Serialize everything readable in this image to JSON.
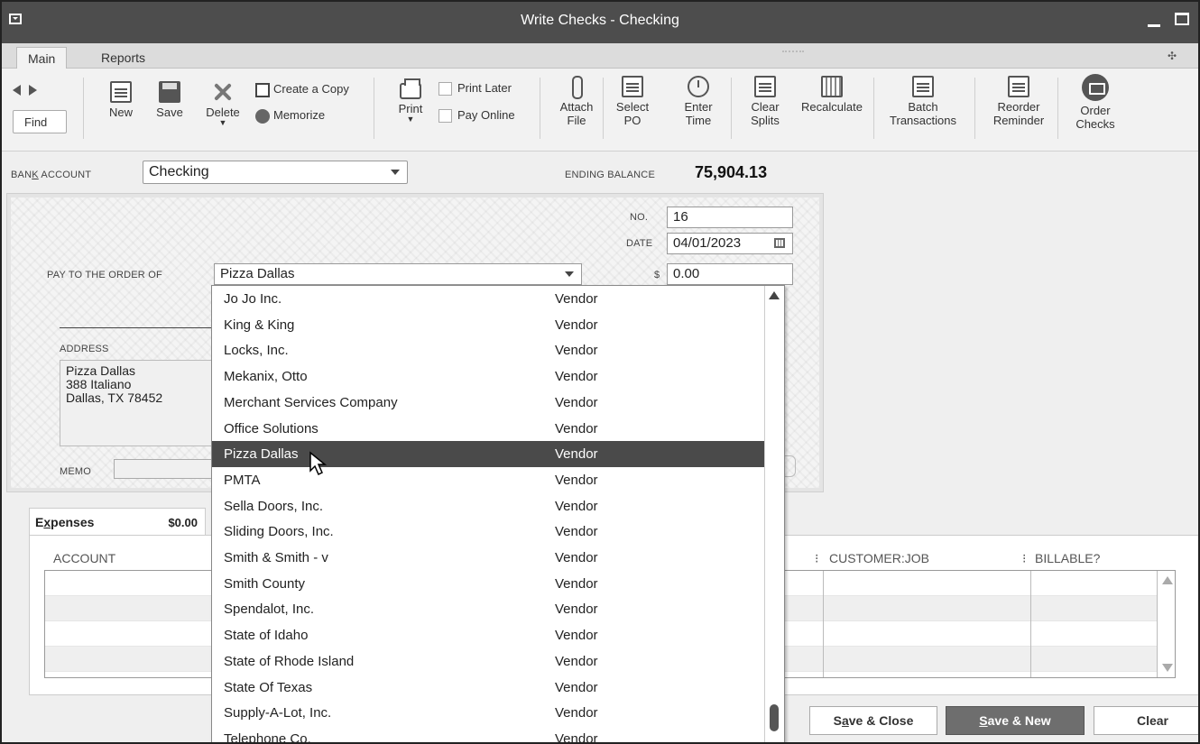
{
  "window": {
    "title": "Write Checks - Checking"
  },
  "tabs": [
    {
      "label": "Main"
    },
    {
      "label": "Reports"
    }
  ],
  "toolbar": {
    "find": "Find",
    "new": "New",
    "save": "Save",
    "delete": "Delete",
    "create_copy": "Create a Copy",
    "memorize": "Memorize",
    "print": "Print",
    "print_later": "Print Later",
    "pay_online": "Pay Online",
    "attach_file_1": "Attach",
    "attach_file_2": "File",
    "select_po_1": "Select",
    "select_po_2": "PO",
    "enter_time_1": "Enter",
    "enter_time_2": "Time",
    "clear_splits_1": "Clear",
    "clear_splits_2": "Splits",
    "recalculate": "Recalculate",
    "batch_1": "Batch",
    "batch_2": "Transactions",
    "reorder_1": "Reorder",
    "reorder_2": "Reminder",
    "order_checks_1": "Order",
    "order_checks_2": "Checks"
  },
  "account": {
    "label_pre": "BAN",
    "label_ul": "K",
    "label_post": " ACCOUNT",
    "value": "Checking",
    "ending_balance_label": "ENDING BALANCE",
    "ending_balance": "75,904.13"
  },
  "check": {
    "no_label": "NO.",
    "no": "16",
    "date_label": "DATE",
    "date": "04/01/2023",
    "payto_label": "PAY TO THE ORDER OF",
    "payee": "Pizza Dallas",
    "dollar_label": "$",
    "amount": "0.00",
    "address_label": "ADDRESS",
    "address_lines": [
      "Pizza Dallas",
      "388 Italiano",
      "Dallas, TX 78452"
    ],
    "memo_label": "MEMO"
  },
  "expenses": {
    "tab_label_pre": "E",
    "tab_label_ul": "x",
    "tab_label_post": "penses",
    "tab_amount": "$0.00",
    "columns": {
      "account": "ACCOUNT",
      "customer_job": "CUSTOMER:JOB",
      "billable": "BILLABLE?"
    }
  },
  "buttons": {
    "save_close_pre": "S",
    "save_close_ul": "a",
    "save_close_post": "ve & Close",
    "save_new_pre": "",
    "save_new_ul": "S",
    "save_new_post": "ave & New",
    "clear": "Clear"
  },
  "vendors": [
    {
      "name": "Jo Jo Inc.",
      "type": "Vendor"
    },
    {
      "name": "King & King",
      "type": "Vendor"
    },
    {
      "name": "Locks, Inc.",
      "type": "Vendor"
    },
    {
      "name": "Mekanix, Otto",
      "type": "Vendor"
    },
    {
      "name": "Merchant Services Company",
      "type": "Vendor"
    },
    {
      "name": "Office Solutions",
      "type": "Vendor"
    },
    {
      "name": "Pizza Dallas",
      "type": "Vendor",
      "selected": true
    },
    {
      "name": "PMTA",
      "type": "Vendor"
    },
    {
      "name": "Sella Doors, Inc.",
      "type": "Vendor"
    },
    {
      "name": "Sliding Doors, Inc.",
      "type": "Vendor"
    },
    {
      "name": "Smith & Smith - v",
      "type": "Vendor"
    },
    {
      "name": "Smith County",
      "type": "Vendor"
    },
    {
      "name": "Spendalot, Inc.",
      "type": "Vendor"
    },
    {
      "name": "State of Idaho",
      "type": "Vendor"
    },
    {
      "name": "State of Rhode Island",
      "type": "Vendor"
    },
    {
      "name": "State Of Texas",
      "type": "Vendor"
    },
    {
      "name": "Supply-A-Lot, Inc.",
      "type": "Vendor"
    },
    {
      "name": "Telephone Co.",
      "type": "Vendor"
    }
  ]
}
